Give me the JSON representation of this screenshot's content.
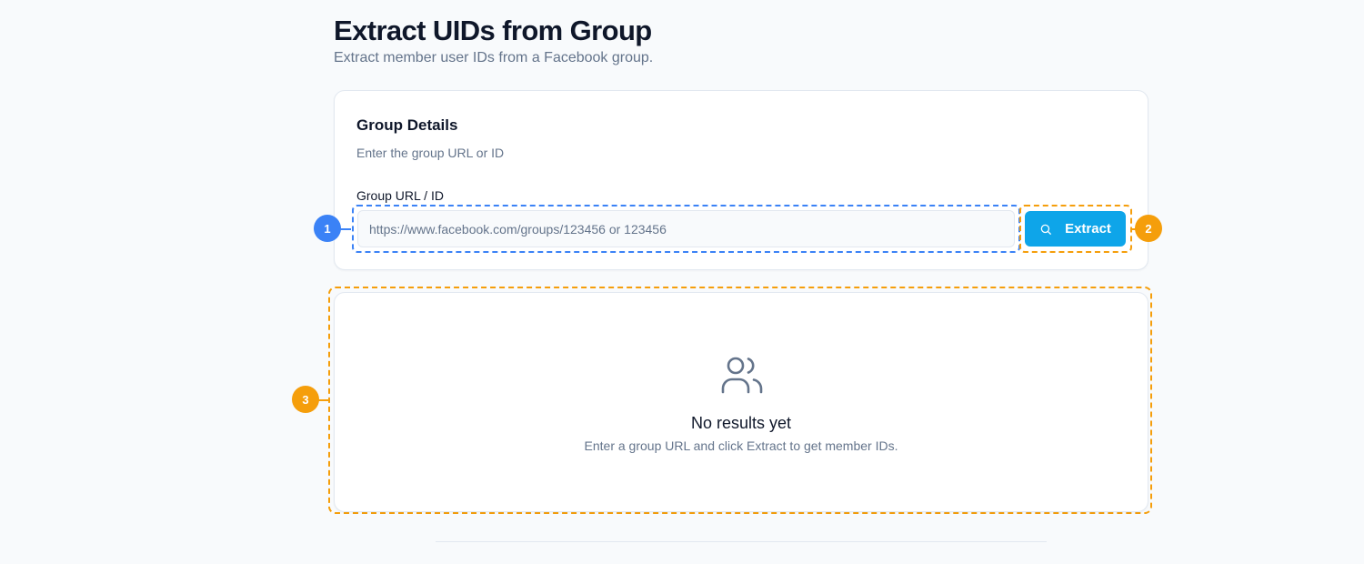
{
  "page": {
    "title": "Extract UIDs from Group",
    "subtitle": "Extract member user IDs from a Facebook group."
  },
  "details": {
    "title": "Group Details",
    "description": "Enter the group URL or ID",
    "field_label": "Group URL / ID",
    "input_value": "",
    "input_placeholder": "https://www.facebook.com/groups/123456 or 123456",
    "extract_label": "Extract",
    "icon": "search-icon"
  },
  "results": {
    "icon": "users-icon",
    "empty_title": "No results yet",
    "empty_description": "Enter a group URL and click Extract to get member IDs."
  },
  "annotations": {
    "marker_1": "1",
    "marker_2": "2",
    "marker_3": "3"
  },
  "colors": {
    "accent": "#0ea5e9",
    "marker_blue": "#3b82f6",
    "marker_orange": "#f59e0b",
    "background": "#f8fafc"
  }
}
